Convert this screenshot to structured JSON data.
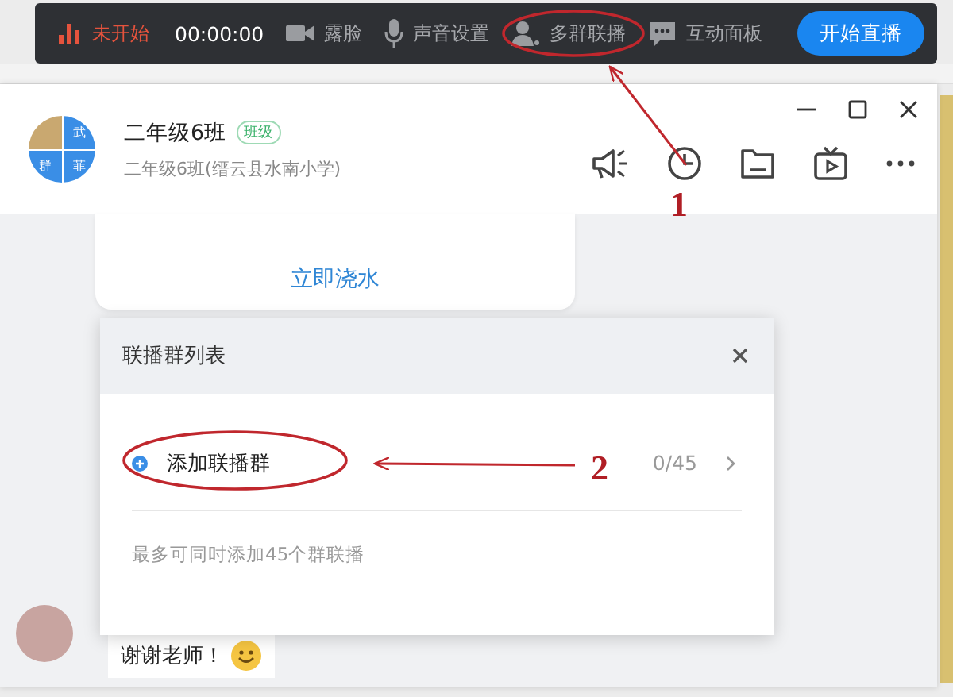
{
  "toolbar": {
    "status": "未开始",
    "timer": "00:00:00",
    "items": [
      {
        "label": "露脸",
        "kind": "camera"
      },
      {
        "label": "声音设置",
        "kind": "mic"
      },
      {
        "label": "多群联播",
        "kind": "person"
      },
      {
        "label": "互动面板",
        "kind": "chat"
      }
    ],
    "start_button": "开始直播"
  },
  "header": {
    "avatar_chars": [
      "武",
      "群",
      "菲"
    ],
    "title": "二年级6班",
    "tag": "班级",
    "subtitle": "二年级6班(缙云县水南小学)"
  },
  "card": {
    "action": "立即浇水"
  },
  "dialog": {
    "title": "联播群列表",
    "add_label": "添加联播群",
    "count": "0/45",
    "hint": "最多可同时添加45个群联播"
  },
  "chat": {
    "message": "谢谢老师！"
  },
  "annotations": [
    {
      "label": "1",
      "kind": "toolbar"
    },
    {
      "label": "2",
      "kind": "dialog"
    }
  ]
}
